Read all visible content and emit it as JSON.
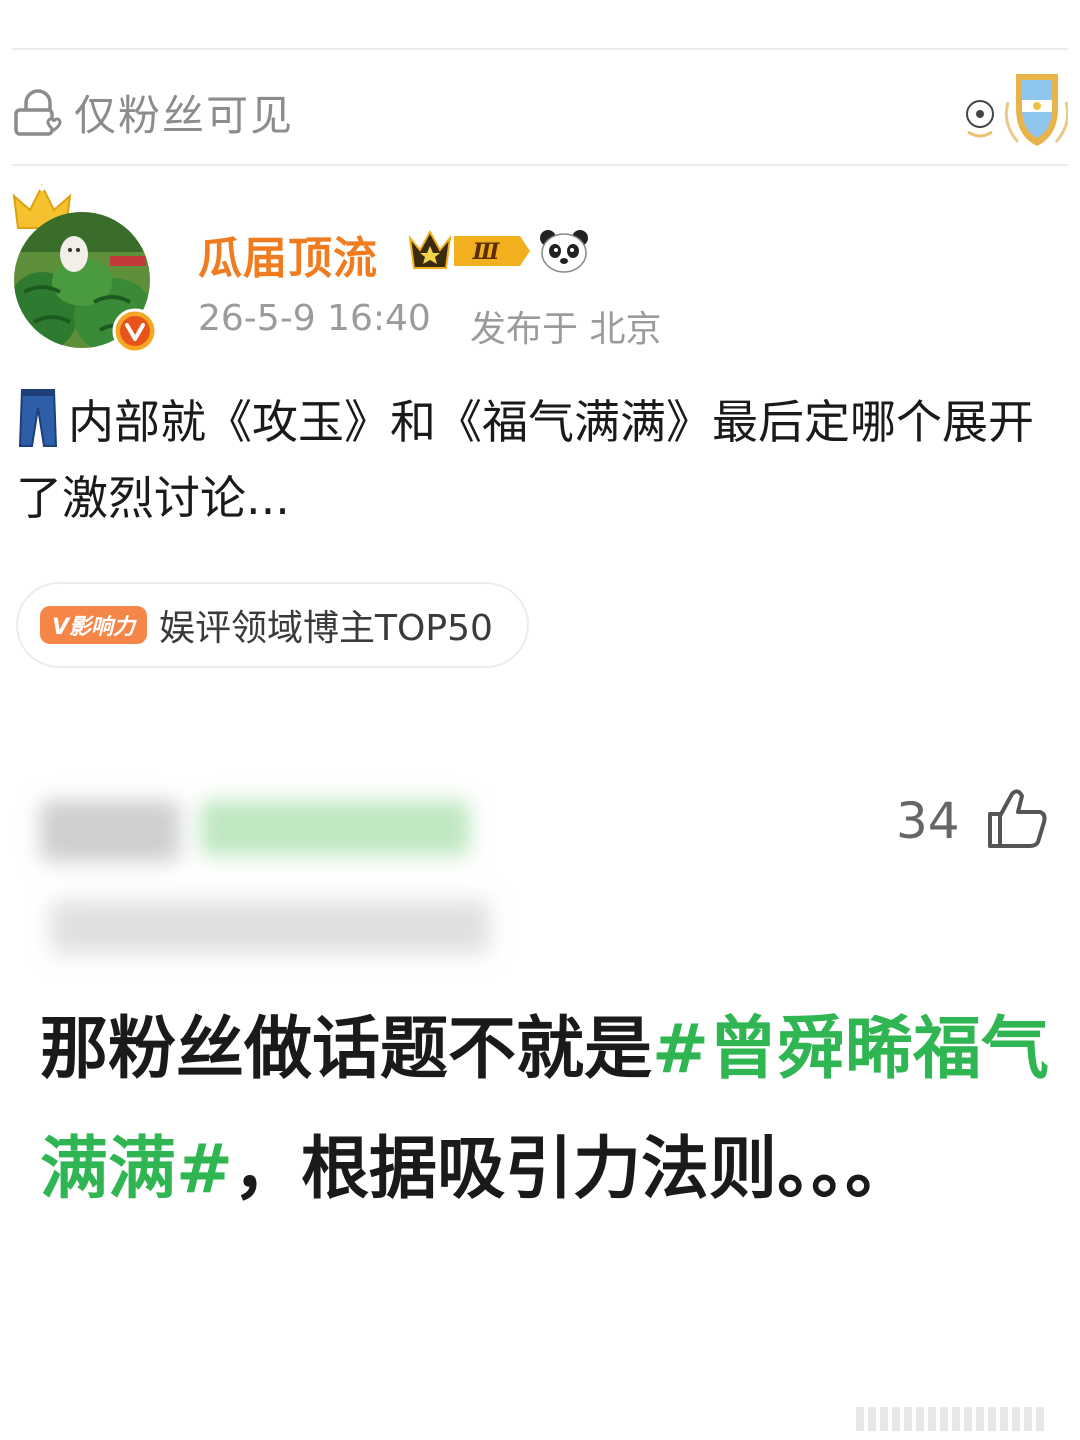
{
  "visibility": {
    "label": "仅粉丝可见",
    "icon": "lock-heart-icon"
  },
  "post": {
    "author": "瓜届顶流",
    "level_badge": "Ⅲ",
    "time": "26-5-9 16:40",
    "location": "发布于 北京",
    "text": "内部就《攻玉》和《福气满满》最后定哪个展开了激烈讨论...",
    "emoji_icon": "jeans-icon",
    "influence_badge": "V影响力",
    "influence_text": "娱评领域博主TOP50"
  },
  "comment": {
    "likes": "34",
    "text_before": "那粉丝做话题不就是",
    "hashtag": "#曾舜晞福气满满#",
    "text_after": "，根据吸引力法则。。。"
  },
  "colors": {
    "author": "#f07c1f",
    "hashtag": "#2fb551",
    "meta": "#9b9b9b",
    "influence_badge": "#f58648"
  }
}
